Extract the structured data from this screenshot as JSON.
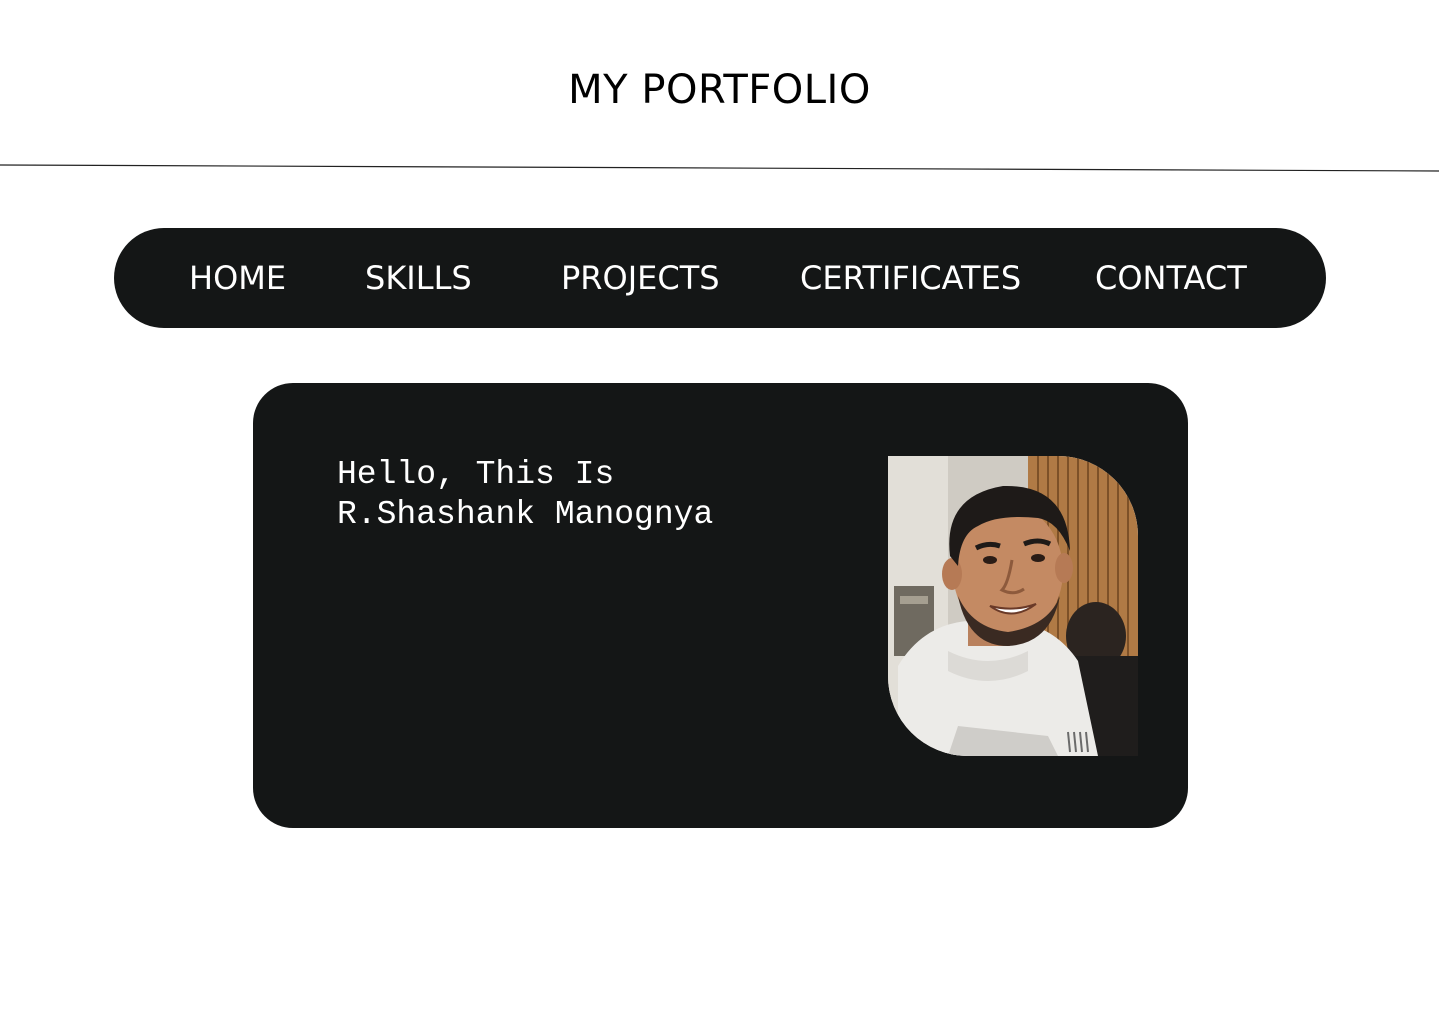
{
  "header": {
    "title": "MY PORTFOLIO"
  },
  "nav": {
    "items": [
      {
        "label": "HOME"
      },
      {
        "label": "SKILLS"
      },
      {
        "label": "PROJECTS"
      },
      {
        "label": "CERTIFICATES"
      },
      {
        "label": "CONTACT"
      }
    ]
  },
  "hero": {
    "greeting_line1": "Hello, This Is",
    "greeting_line2": "R.Shashank Manognya",
    "photo_icon": "profile-photo"
  },
  "colors": {
    "background": "#ffffff",
    "panel": "#141616",
    "text_light": "#ffffff",
    "text_dark": "#000000"
  }
}
